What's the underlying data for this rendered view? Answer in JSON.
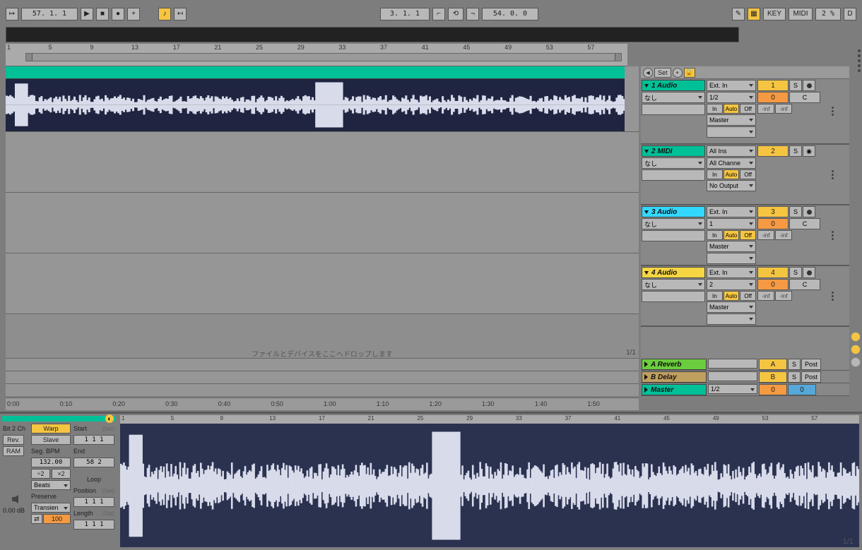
{
  "transport": {
    "position": "57.  1.  1",
    "loop_pos": "3.  1.  1",
    "tempo": "54.  0.  0",
    "key_label": "KEY",
    "midi_label": "MIDI",
    "midi_pct": "2 %",
    "d_label": "D"
  },
  "timeline_markers": [
    "1",
    "5",
    "9",
    "13",
    "17",
    "21",
    "25",
    "29",
    "33",
    "37",
    "41",
    "45",
    "49",
    "53",
    "57"
  ],
  "time_ruler": [
    "0:00",
    "0:10",
    "0:20",
    "0:30",
    "0:40",
    "0:50",
    "1:00",
    "1:10",
    "1:20",
    "1:30",
    "1:40",
    "1:50"
  ],
  "drop_text": "ファイルとデバイスをここへドロップします",
  "loop_fraction": "1/1",
  "mixer_header": {
    "set": "Set"
  },
  "tracks": [
    {
      "name": "1 Audio",
      "color": "#00c098",
      "none": "なし",
      "ext": "Ext. In",
      "io": "1/2",
      "auto": "Auto",
      "master": "Master",
      "num": "1",
      "send": "0",
      "c": "C",
      "inf": "-inf"
    },
    {
      "name": "2 MIDI",
      "color": "#00c098",
      "none": "なし",
      "ext": "All Ins",
      "io": "All Channe",
      "auto": "Auto",
      "master": "No Output",
      "num": "2"
    },
    {
      "name": "3 Audio",
      "color": "#33d8ff",
      "none": "なし",
      "ext": "Ext. In",
      "io": "1",
      "auto": "Auto",
      "master": "Master",
      "num": "3",
      "send": "0",
      "c": "C",
      "inf": "-inf",
      "off_active": true
    },
    {
      "name": "4 Audio",
      "color": "#f5d542",
      "none": "なし",
      "ext": "Ext. In",
      "io": "2",
      "auto": "Auto",
      "master": "Master",
      "num": "4",
      "send": "0",
      "c": "C",
      "inf": "-inf"
    }
  ],
  "returns": [
    {
      "name": "A Reverb",
      "color": "#6bcc3e",
      "letter": "A",
      "btn": "Post"
    },
    {
      "name": "B Delay",
      "color": "#c0a060",
      "letter": "B",
      "btn": "Post"
    }
  ],
  "master": {
    "name": "Master",
    "color": "#00c098",
    "io": "1/2",
    "a": "0",
    "b": "0"
  },
  "clip": {
    "bit": "Bit 2 Ch",
    "rev": "Rev.",
    "ram": "RAM",
    "warp": "Warp",
    "slave": "Slave",
    "segbpm": "Seg. BPM",
    "bpm": "132.00",
    "beats": "Beats",
    "preserve": "Preserve",
    "transient": "Transien",
    "hundred": "100",
    "start": "Start",
    "end": "End",
    "loop": "Loop",
    "position": "Position",
    "length": "Length",
    "set": "(Set)",
    "s111": "1   1   1",
    "s582": "58   2",
    "m2a": "÷2",
    "m2b": "×2",
    "gain": "0.00 dB",
    "ruler": [
      "1",
      "5",
      "9",
      "13",
      "17",
      "21",
      "25",
      "29",
      "33",
      "37",
      "41",
      "45",
      "49",
      "53",
      "57"
    ],
    "frac": "1/1"
  },
  "io_labels": {
    "in": "In",
    "off": "Off",
    "s": "S"
  }
}
